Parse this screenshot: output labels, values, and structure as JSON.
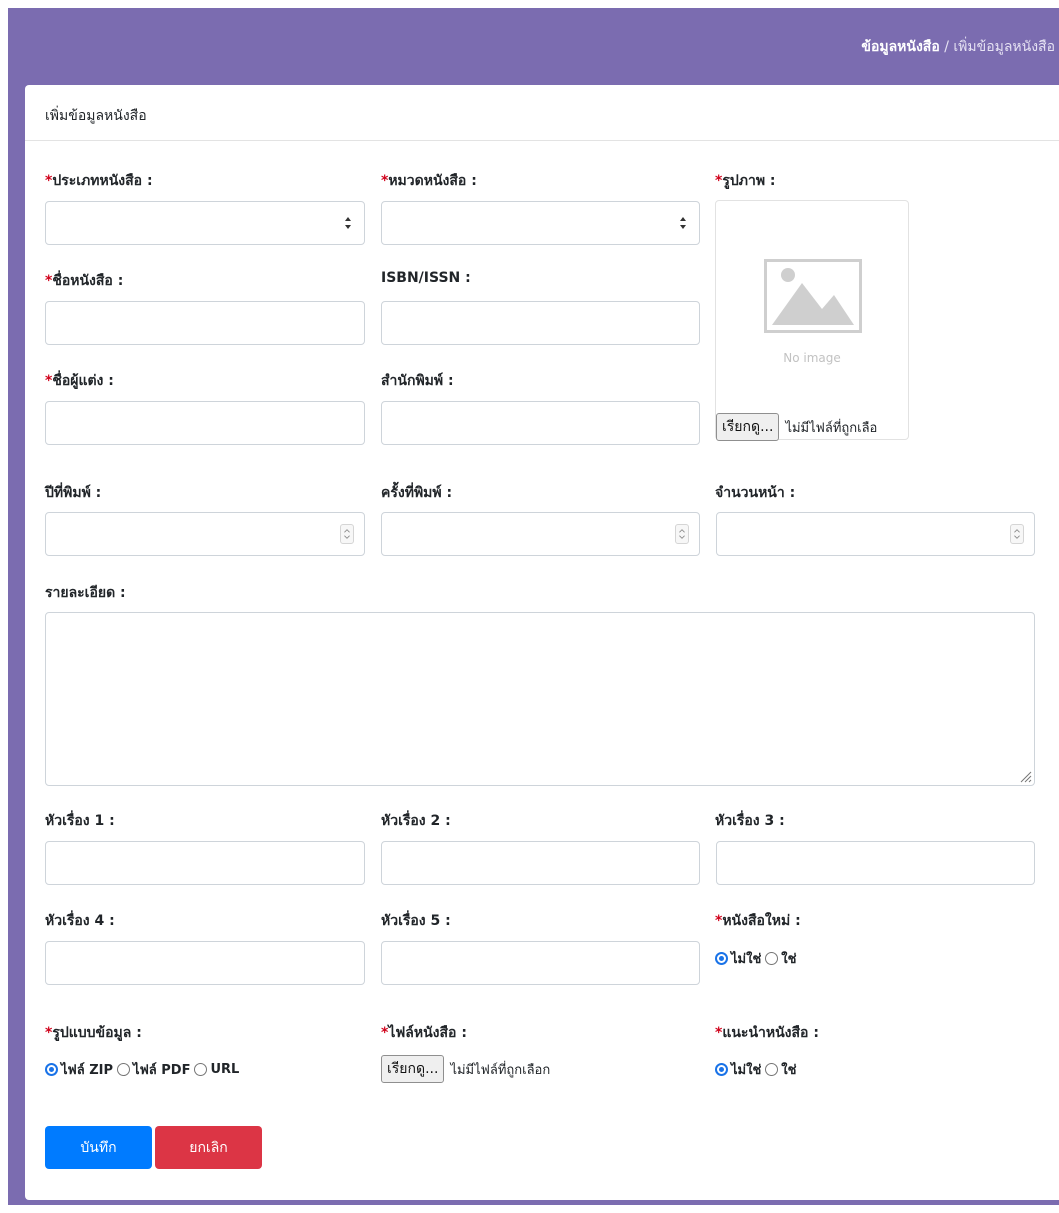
{
  "breadcrumb": {
    "parent": "ข้อมูลหนังสือ",
    "separator": " / ",
    "current": "เพิ่มข้อมูลหนังสือ"
  },
  "card": {
    "title": "เพิ่มข้อมูลหนังสือ"
  },
  "required_mark": "*",
  "fields": {
    "book_type": {
      "label": "ประเภทหนังสือ :",
      "value": ""
    },
    "category": {
      "label": "หมวดหนังสือ :",
      "value": ""
    },
    "image": {
      "label": "รูปภาพ :",
      "placeholder_text": "No image"
    },
    "book_name": {
      "label": "ชื่อหนังสือ :",
      "value": ""
    },
    "isbn": {
      "label": "ISBN/ISSN :",
      "value": ""
    },
    "author": {
      "label": "ชื่อผู้แต่ง :",
      "value": ""
    },
    "publisher": {
      "label": "สำนักพิมพ์ :",
      "value": ""
    },
    "year": {
      "label": "ปีที่พิมพ์ :",
      "value": ""
    },
    "edition": {
      "label": "ครั้งที่พิมพ์ :",
      "value": ""
    },
    "pages": {
      "label": "จำนวนหน้า :",
      "value": ""
    },
    "details": {
      "label": "รายละเอียด :",
      "value": ""
    },
    "subject1": {
      "label": "หัวเรื่อง 1 :",
      "value": ""
    },
    "subject2": {
      "label": "หัวเรื่อง 2 :",
      "value": ""
    },
    "subject3": {
      "label": "หัวเรื่อง 3 :",
      "value": ""
    },
    "subject4": {
      "label": "หัวเรื่อง 4 :",
      "value": ""
    },
    "subject5": {
      "label": "หัวเรื่อง 5 :",
      "value": ""
    },
    "new_book": {
      "label": "หนังสือใหม่ :",
      "options": [
        "ไม่ใช่",
        "ใช่"
      ],
      "selected": "ไม่ใช่"
    },
    "data_format": {
      "label": "รูปแบบข้อมูล :",
      "options": [
        "ไฟล์ ZIP",
        "ไฟล์ PDF",
        "URL"
      ],
      "selected": "ไฟล์ ZIP"
    },
    "book_file": {
      "label": "ไฟล์หนังสือ :"
    },
    "recommend": {
      "label": "แนะนำหนังสือ :",
      "options": [
        "ไม่ใช่",
        "ใช่"
      ],
      "selected": "ไม่ใช่"
    }
  },
  "file_input": {
    "button": "เรียกดู...",
    "status": "ไม่มีไฟล์ที่ถูกเลือก",
    "status_truncated": "ไม่มีไฟล์ที่ถูกเลือ"
  },
  "buttons": {
    "save": "บันทึก",
    "cancel": "ยกเลิก"
  },
  "colors": {
    "header_bg": "#7b6cb0",
    "primary": "#007bff",
    "danger": "#dc3545",
    "required": "#d0021b",
    "radio": "#1a73e8"
  }
}
